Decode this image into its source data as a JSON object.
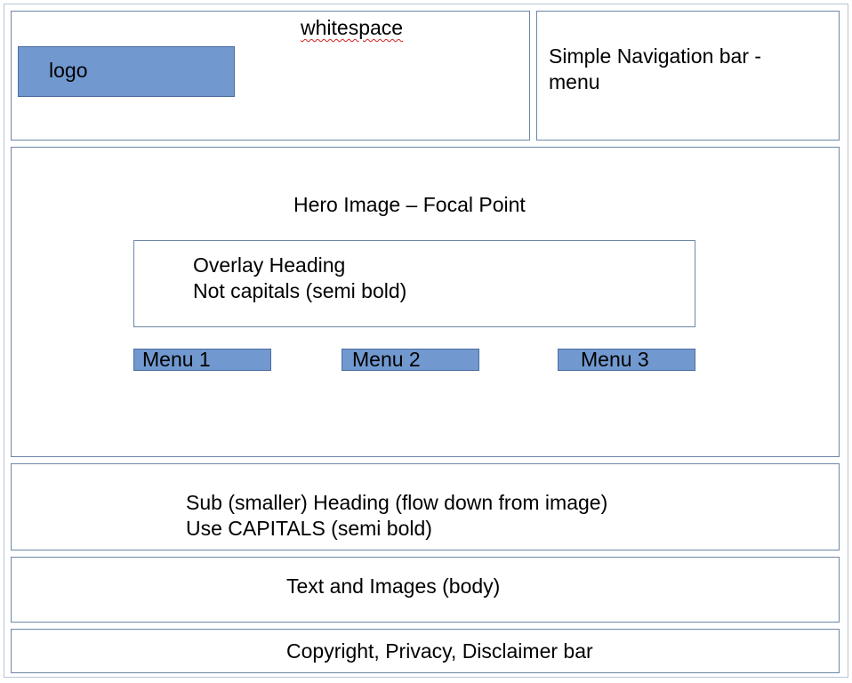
{
  "header": {
    "whitespace_label": "whitespace",
    "logo_label": "logo",
    "nav_label_line1": "Simple Navigation bar -",
    "nav_label_line2": "menu"
  },
  "hero": {
    "title": "Hero Image – Focal Point",
    "overlay_line1": "Overlay Heading",
    "overlay_line2": "Not capitals (semi bold)",
    "menus": [
      "Menu 1",
      "Menu 2",
      "Menu 3"
    ]
  },
  "subheading": {
    "line1": "Sub (smaller) Heading (flow down from image)",
    "line2": "Use CAPITALS (semi bold)"
  },
  "body_section": {
    "label": "Text and Images (body)"
  },
  "footer": {
    "label": "Copyright, Privacy, Disclaimer bar"
  },
  "colors": {
    "block_fill": "#7299cf",
    "box_border": "#6e86a8",
    "spell_underline": "#d42020"
  }
}
